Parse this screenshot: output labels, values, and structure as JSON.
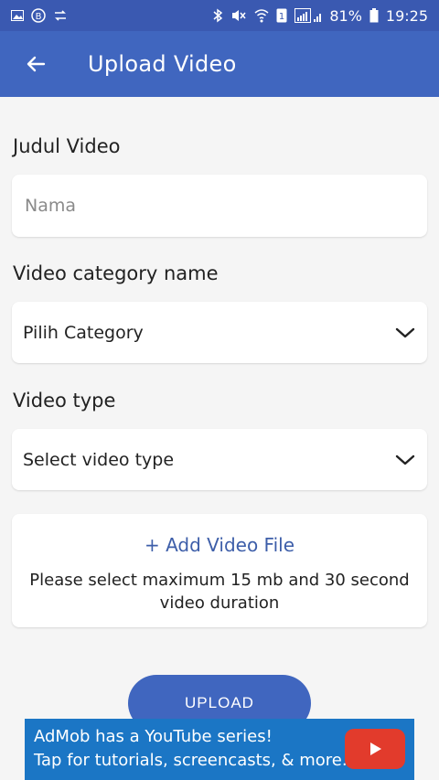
{
  "status_bar": {
    "battery": "81%",
    "time": "19:25"
  },
  "appbar": {
    "title": "Upload Video"
  },
  "form": {
    "title_label": "Judul Video",
    "title_placeholder": "Nama",
    "category_label": "Video category name",
    "category_value": "Pilih Category",
    "type_label": "Video type",
    "type_value": "Select video type",
    "add_file_label": "+ Add Video File",
    "file_hint": "Please select maximum 15 mb and 30 second video duration",
    "upload_label": "UPLOAD"
  },
  "ad": {
    "line1": "AdMob has a YouTube series!",
    "line2": "Tap for tutorials, screencasts, & more."
  },
  "colors": {
    "primary": "#4066bf",
    "status_bar": "#3a59b1",
    "link": "#3d5ea9",
    "ad_background": "#1b76c5",
    "youtube_red": "#e23b2c"
  }
}
